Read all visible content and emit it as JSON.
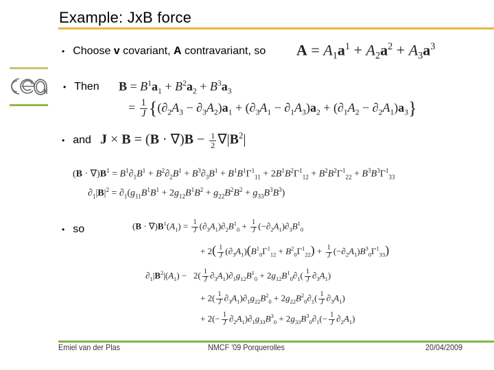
{
  "slide": {
    "title": "Example: JxB force",
    "accent_colors": {
      "title_rule": "#e8b73c",
      "footer_rule": "#82b446",
      "logo_top": "#c9c36b",
      "logo_bottom": "#8cbb44",
      "logo_mark": "#666666"
    },
    "logo": {
      "text": "cea"
    },
    "bullets": [
      {
        "bullet": "•",
        "text_before": "Choose ",
        "bold1": "v",
        "text_mid": " covariant, ",
        "bold2": "A",
        "text_after": " contravariant, so"
      },
      {
        "bullet": "•",
        "text": "Then"
      },
      {
        "bullet": "•",
        "text": "and"
      },
      {
        "bullet": "•",
        "text": "so"
      }
    ],
    "equations": {
      "A_def": "A = A₁a¹ + A₂a² + A₃a³",
      "B_def_1": "B = B¹a₁ + B²a₂ + B³a₃",
      "B_def_2": "= 1/J {(∂₂A₃ − ∂₃A₂)a₁ + (∂₃A₁ − ∂₁A₃)a₂ + (∂₁A₂ − ∂₂A₁)a₃}",
      "JxB": "J × B = (B·∇)B − ½∇|B²|",
      "BgradB1": "(B·∇)B¹ = B¹∂₁B¹ + B²∂₂B¹ + B³∂₃B¹ + B¹B¹Γ¹₁₁ + 2B¹B²Γ¹₁₂ + B²B²Γ¹₂₂ + B³B³Γ¹₃₃",
      "d1B2": "∂₁|B|² = ∂₁(g₁₁B¹B¹ + 2g₁₂B¹B² + g₂₂B²B² + g₃₃B³B³)",
      "so_1": "(B·∇)B¹(A₁) = 1/J(∂₃A₁)∂₂B¹₀ + 1/J(−∂₂A₁)∂₃B¹₀",
      "so_2": "+ 2(1/J(∂₃A₁)(B¹₀Γ¹₁₂ + B²₀Γ¹₂₂) + 1/J(−∂₂A₁)B³₀Γ¹₃₃)",
      "so_3": "∂₁|B²|(A₁) = 2(1/J∂₃A₁)∂₁g₁₂B¹₀ + 2g₁₂B¹₀∂₁(1/J∂₃A₁)",
      "so_4": "+ 2(1/J∂₃A₁)∂₁g₂₂B²₀ + 2g₂₂B²₀∂₁(1/J∂₃A₁)",
      "so_5": "+ 2(−1/J∂₂A₁)∂₁g₃₃B³₀ + 2g₃₃B³₀∂₁(−1/J∂₂A₁)"
    },
    "footer": {
      "author": "Emiel van der Plas",
      "event": "NMCF '09 Porquerolles",
      "date": "20/04/2009"
    }
  }
}
